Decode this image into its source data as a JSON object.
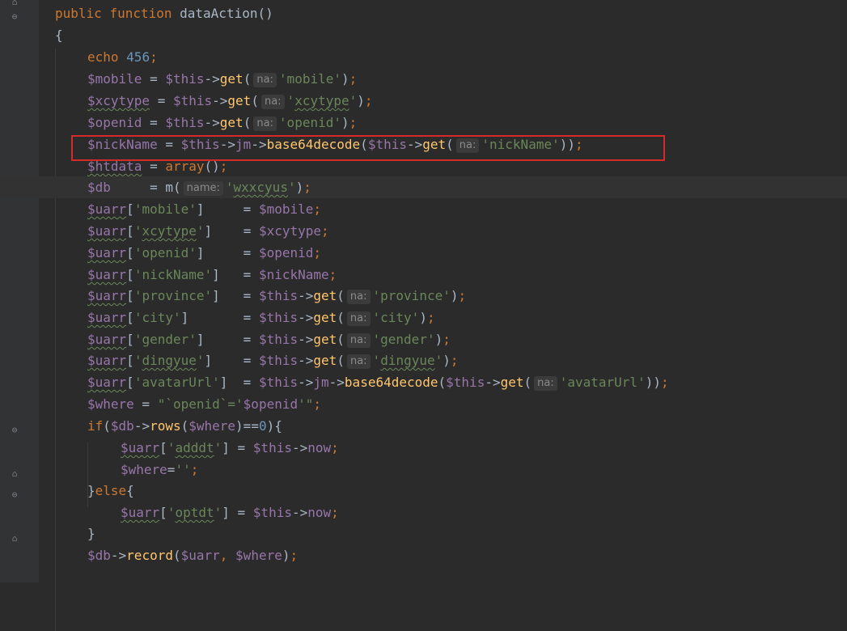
{
  "editor": {
    "lines": [
      {
        "tokens": [
          {
            "t": "public ",
            "c": "kw"
          },
          {
            "t": "function ",
            "c": "kw"
          },
          {
            "t": "dataAction",
            "c": "plain"
          },
          {
            "t": "()",
            "c": "plain"
          }
        ]
      },
      {
        "tokens": [
          {
            "t": "{",
            "c": "plain"
          }
        ]
      },
      {
        "tokens": [
          {
            "t": "echo ",
            "c": "kw"
          },
          {
            "t": "456",
            "c": "num"
          },
          {
            "t": ";",
            "c": "kw"
          }
        ]
      },
      {
        "tokens": [
          {
            "t": "$mobile",
            "c": "var"
          },
          {
            "t": " = ",
            "c": "plain"
          },
          {
            "t": "$this",
            "c": "var"
          },
          {
            "t": "->",
            "c": "plain"
          },
          {
            "t": "get",
            "c": "fn"
          },
          {
            "t": "(",
            "c": "plain"
          },
          {
            "t": "na:",
            "c": "hint"
          },
          {
            "t": "'mobile'",
            "c": "str"
          },
          {
            "t": ")",
            "c": "plain"
          },
          {
            "t": ";",
            "c": "kw"
          }
        ]
      },
      {
        "tokens": [
          {
            "t": "$xcytype",
            "c": "var",
            "sq": true
          },
          {
            "t": " = ",
            "c": "plain"
          },
          {
            "t": "$this",
            "c": "var"
          },
          {
            "t": "->",
            "c": "plain"
          },
          {
            "t": "get",
            "c": "fn"
          },
          {
            "t": "(",
            "c": "plain"
          },
          {
            "t": "na:",
            "c": "hint"
          },
          {
            "t": "'",
            "c": "str"
          },
          {
            "t": "xcytype",
            "c": "str",
            "sq": true
          },
          {
            "t": "'",
            "c": "str"
          },
          {
            "t": ")",
            "c": "plain"
          },
          {
            "t": ";",
            "c": "kw"
          }
        ]
      },
      {
        "tokens": [
          {
            "t": "$openid",
            "c": "var"
          },
          {
            "t": " = ",
            "c": "plain"
          },
          {
            "t": "$this",
            "c": "var"
          },
          {
            "t": "->",
            "c": "plain"
          },
          {
            "t": "get",
            "c": "fn"
          },
          {
            "t": "(",
            "c": "plain"
          },
          {
            "t": "na:",
            "c": "hint"
          },
          {
            "t": "'openid'",
            "c": "str"
          },
          {
            "t": ")",
            "c": "plain"
          },
          {
            "t": ";",
            "c": "kw"
          }
        ]
      },
      {
        "tokens": [
          {
            "t": "$nickName",
            "c": "var"
          },
          {
            "t": " = ",
            "c": "plain"
          },
          {
            "t": "$this",
            "c": "var"
          },
          {
            "t": "->",
            "c": "plain"
          },
          {
            "t": "jm",
            "c": "var"
          },
          {
            "t": "->",
            "c": "plain"
          },
          {
            "t": "base64decode",
            "c": "fn"
          },
          {
            "t": "(",
            "c": "plain"
          },
          {
            "t": "$this",
            "c": "var"
          },
          {
            "t": "->",
            "c": "plain"
          },
          {
            "t": "get",
            "c": "fn"
          },
          {
            "t": "(",
            "c": "plain"
          },
          {
            "t": "na:",
            "c": "hint"
          },
          {
            "t": "'nickName'",
            "c": "str"
          },
          {
            "t": "))",
            "c": "plain"
          },
          {
            "t": ";",
            "c": "kw"
          }
        ]
      },
      {
        "tokens": [
          {
            "t": "$htdata",
            "c": "var",
            "sq": true
          },
          {
            "t": " = ",
            "c": "plain"
          },
          {
            "t": "array",
            "c": "kw"
          },
          {
            "t": "()",
            "c": "plain"
          },
          {
            "t": ";",
            "c": "kw"
          }
        ]
      },
      {
        "current": true,
        "tokens": [
          {
            "t": "$db",
            "c": "var"
          },
          {
            "t": "     = ",
            "c": "plain"
          },
          {
            "t": "m",
            "c": "plain"
          },
          {
            "t": "(",
            "c": "plain"
          },
          {
            "t": "name:",
            "c": "hint"
          },
          {
            "t": "'",
            "c": "str"
          },
          {
            "t": "wxxcyus",
            "c": "str",
            "sq": true
          },
          {
            "t": "'",
            "c": "str"
          },
          {
            "t": ")",
            "c": "plain"
          },
          {
            "t": ";",
            "c": "kw"
          }
        ]
      },
      {
        "tokens": [
          {
            "t": "$uarr",
            "c": "var",
            "sq": true
          },
          {
            "t": "[",
            "c": "plain"
          },
          {
            "t": "'mobile'",
            "c": "str"
          },
          {
            "t": "]     = ",
            "c": "plain"
          },
          {
            "t": "$mobile",
            "c": "var"
          },
          {
            "t": ";",
            "c": "kw"
          }
        ]
      },
      {
        "tokens": [
          {
            "t": "$uarr",
            "c": "var",
            "sq": true
          },
          {
            "t": "[",
            "c": "plain"
          },
          {
            "t": "'",
            "c": "str"
          },
          {
            "t": "xcytype",
            "c": "str",
            "sq": true
          },
          {
            "t": "'",
            "c": "str"
          },
          {
            "t": "]    = ",
            "c": "plain"
          },
          {
            "t": "$xcytype",
            "c": "var"
          },
          {
            "t": ";",
            "c": "kw"
          }
        ]
      },
      {
        "tokens": [
          {
            "t": "$uarr",
            "c": "var",
            "sq": true
          },
          {
            "t": "[",
            "c": "plain"
          },
          {
            "t": "'openid'",
            "c": "str"
          },
          {
            "t": "]     = ",
            "c": "plain"
          },
          {
            "t": "$openid",
            "c": "var"
          },
          {
            "t": ";",
            "c": "kw"
          }
        ]
      },
      {
        "tokens": [
          {
            "t": "$uarr",
            "c": "var",
            "sq": true
          },
          {
            "t": "[",
            "c": "plain"
          },
          {
            "t": "'nickName'",
            "c": "str"
          },
          {
            "t": "]   = ",
            "c": "plain"
          },
          {
            "t": "$nickName",
            "c": "var"
          },
          {
            "t": ";",
            "c": "kw"
          }
        ]
      },
      {
        "tokens": [
          {
            "t": "$uarr",
            "c": "var",
            "sq": true
          },
          {
            "t": "[",
            "c": "plain"
          },
          {
            "t": "'province'",
            "c": "str"
          },
          {
            "t": "]   = ",
            "c": "plain"
          },
          {
            "t": "$this",
            "c": "var"
          },
          {
            "t": "->",
            "c": "plain"
          },
          {
            "t": "get",
            "c": "fn"
          },
          {
            "t": "(",
            "c": "plain"
          },
          {
            "t": "na:",
            "c": "hint"
          },
          {
            "t": "'province'",
            "c": "str"
          },
          {
            "t": ")",
            "c": "plain"
          },
          {
            "t": ";",
            "c": "kw"
          }
        ]
      },
      {
        "tokens": [
          {
            "t": "$uarr",
            "c": "var",
            "sq": true
          },
          {
            "t": "[",
            "c": "plain"
          },
          {
            "t": "'city'",
            "c": "str"
          },
          {
            "t": "]       = ",
            "c": "plain"
          },
          {
            "t": "$this",
            "c": "var"
          },
          {
            "t": "->",
            "c": "plain"
          },
          {
            "t": "get",
            "c": "fn"
          },
          {
            "t": "(",
            "c": "plain"
          },
          {
            "t": "na:",
            "c": "hint"
          },
          {
            "t": "'city'",
            "c": "str"
          },
          {
            "t": ")",
            "c": "plain"
          },
          {
            "t": ";",
            "c": "kw"
          }
        ]
      },
      {
        "tokens": [
          {
            "t": "$uarr",
            "c": "var",
            "sq": true
          },
          {
            "t": "[",
            "c": "plain"
          },
          {
            "t": "'gender'",
            "c": "str"
          },
          {
            "t": "]     = ",
            "c": "plain"
          },
          {
            "t": "$this",
            "c": "var"
          },
          {
            "t": "->",
            "c": "plain"
          },
          {
            "t": "get",
            "c": "fn"
          },
          {
            "t": "(",
            "c": "plain"
          },
          {
            "t": "na:",
            "c": "hint"
          },
          {
            "t": "'gender'",
            "c": "str"
          },
          {
            "t": ")",
            "c": "plain"
          },
          {
            "t": ";",
            "c": "kw"
          }
        ]
      },
      {
        "tokens": [
          {
            "t": "$uarr",
            "c": "var",
            "sq": true
          },
          {
            "t": "[",
            "c": "plain"
          },
          {
            "t": "'",
            "c": "str"
          },
          {
            "t": "dingyue",
            "c": "str",
            "sq": true
          },
          {
            "t": "'",
            "c": "str"
          },
          {
            "t": "]    = ",
            "c": "plain"
          },
          {
            "t": "$this",
            "c": "var"
          },
          {
            "t": "->",
            "c": "plain"
          },
          {
            "t": "get",
            "c": "fn"
          },
          {
            "t": "(",
            "c": "plain"
          },
          {
            "t": "na:",
            "c": "hint"
          },
          {
            "t": "'",
            "c": "str"
          },
          {
            "t": "dingyue",
            "c": "str",
            "sq": true
          },
          {
            "t": "'",
            "c": "str"
          },
          {
            "t": ")",
            "c": "plain"
          },
          {
            "t": ";",
            "c": "kw"
          }
        ]
      },
      {
        "tokens": [
          {
            "t": "$uarr",
            "c": "var",
            "sq": true
          },
          {
            "t": "[",
            "c": "plain"
          },
          {
            "t": "'avatarUrl'",
            "c": "str"
          },
          {
            "t": "]  = ",
            "c": "plain"
          },
          {
            "t": "$this",
            "c": "var"
          },
          {
            "t": "->",
            "c": "plain"
          },
          {
            "t": "jm",
            "c": "var"
          },
          {
            "t": "->",
            "c": "plain"
          },
          {
            "t": "base64decode",
            "c": "fn"
          },
          {
            "t": "(",
            "c": "plain"
          },
          {
            "t": "$this",
            "c": "var"
          },
          {
            "t": "->",
            "c": "plain"
          },
          {
            "t": "get",
            "c": "fn"
          },
          {
            "t": "(",
            "c": "plain"
          },
          {
            "t": "na:",
            "c": "hint"
          },
          {
            "t": "'avatarUrl'",
            "c": "str"
          },
          {
            "t": "))",
            "c": "plain"
          },
          {
            "t": ";",
            "c": "kw"
          }
        ]
      },
      {
        "tokens": [
          {
            "t": "$where",
            "c": "var"
          },
          {
            "t": " = ",
            "c": "plain"
          },
          {
            "t": "\"`openid`='",
            "c": "str"
          },
          {
            "t": "$openid",
            "c": "var"
          },
          {
            "t": "'\"",
            "c": "str"
          },
          {
            "t": ";",
            "c": "kw"
          }
        ]
      },
      {
        "tokens": [
          {
            "t": "if",
            "c": "kw"
          },
          {
            "t": "(",
            "c": "plain"
          },
          {
            "t": "$db",
            "c": "var"
          },
          {
            "t": "->",
            "c": "plain"
          },
          {
            "t": "rows",
            "c": "fn"
          },
          {
            "t": "(",
            "c": "plain"
          },
          {
            "t": "$where",
            "c": "var"
          },
          {
            "t": ")==",
            "c": "plain"
          },
          {
            "t": "0",
            "c": "num"
          },
          {
            "t": "){",
            "c": "plain"
          }
        ]
      },
      {
        "tokens": [
          {
            "t": "$uarr",
            "c": "var",
            "sq": true
          },
          {
            "t": "[",
            "c": "plain"
          },
          {
            "t": "'",
            "c": "str"
          },
          {
            "t": "adddt",
            "c": "str",
            "sq": true
          },
          {
            "t": "'",
            "c": "str"
          },
          {
            "t": "] = ",
            "c": "plain"
          },
          {
            "t": "$this",
            "c": "var"
          },
          {
            "t": "->",
            "c": "plain"
          },
          {
            "t": "now",
            "c": "var"
          },
          {
            "t": ";",
            "c": "kw"
          }
        ]
      },
      {
        "tokens": [
          {
            "t": "$where",
            "c": "var"
          },
          {
            "t": "=",
            "c": "plain"
          },
          {
            "t": "''",
            "c": "str"
          },
          {
            "t": ";",
            "c": "kw"
          }
        ]
      },
      {
        "tokens": [
          {
            "t": "}",
            "c": "plain"
          },
          {
            "t": "else",
            "c": "kw"
          },
          {
            "t": "{",
            "c": "plain"
          }
        ]
      },
      {
        "tokens": [
          {
            "t": "$uarr",
            "c": "var",
            "sq": true
          },
          {
            "t": "[",
            "c": "plain"
          },
          {
            "t": "'",
            "c": "str"
          },
          {
            "t": "optdt",
            "c": "str",
            "sq": true
          },
          {
            "t": "'",
            "c": "str"
          },
          {
            "t": "] = ",
            "c": "plain"
          },
          {
            "t": "$this",
            "c": "var"
          },
          {
            "t": "->",
            "c": "plain"
          },
          {
            "t": "now",
            "c": "var"
          },
          {
            "t": ";",
            "c": "kw"
          }
        ]
      },
      {
        "tokens": [
          {
            "t": "}",
            "c": "plain"
          }
        ]
      },
      {
        "tokens": [
          {
            "t": "$db",
            "c": "var"
          },
          {
            "t": "->",
            "c": "plain"
          },
          {
            "t": "record",
            "c": "fn"
          },
          {
            "t": "(",
            "c": "plain"
          },
          {
            "t": "$uarr",
            "c": "var"
          },
          {
            "t": ", ",
            "c": "kw"
          },
          {
            "t": "$where",
            "c": "var"
          },
          {
            "t": ")",
            "c": "plain"
          },
          {
            "t": ";",
            "c": "kw"
          }
        ]
      }
    ]
  }
}
